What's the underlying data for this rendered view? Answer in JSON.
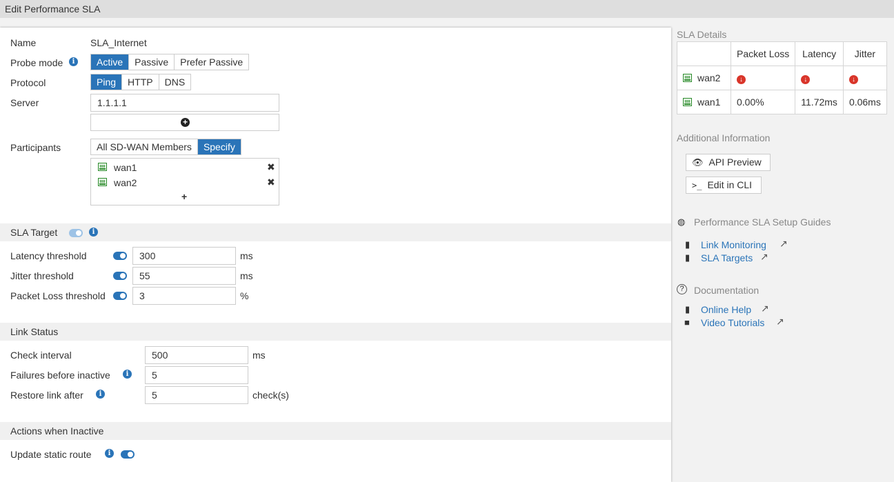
{
  "window": {
    "title": "Edit Performance SLA"
  },
  "form": {
    "name_label": "Name",
    "name_value": "SLA_Internet",
    "probe_mode_label": "Probe mode",
    "probe_modes": [
      "Active",
      "Passive",
      "Prefer Passive"
    ],
    "probe_mode_selected": "Active",
    "protocol_label": "Protocol",
    "protocols": [
      "Ping",
      "HTTP",
      "DNS"
    ],
    "protocol_selected": "Ping",
    "server_label": "Server",
    "server_value": "1.1.1.1",
    "participants_label": "Participants",
    "participant_modes": [
      "All SD-WAN Members",
      "Specify"
    ],
    "participant_mode_selected": "Specify",
    "participants": [
      "wan1",
      "wan2"
    ],
    "add_symbol": "+"
  },
  "sla_target": {
    "title": "SLA Target",
    "latency_label": "Latency threshold",
    "latency_value": "300",
    "latency_unit": "ms",
    "jitter_label": "Jitter threshold",
    "jitter_value": "55",
    "jitter_unit": "ms",
    "loss_label": "Packet Loss threshold",
    "loss_value": "3",
    "loss_unit": "%"
  },
  "link_status": {
    "title": "Link Status",
    "check_label": "Check interval",
    "check_value": "500",
    "check_unit": "ms",
    "failures_label": "Failures before inactive",
    "failures_value": "5",
    "restore_label": "Restore link after",
    "restore_value": "5",
    "restore_unit": "check(s)"
  },
  "actions": {
    "title": "Actions when Inactive",
    "update_route_label": "Update static route"
  },
  "sla_details": {
    "title": "SLA Details",
    "columns": [
      "Packet Loss",
      "Latency",
      "Jitter"
    ],
    "rows": [
      {
        "name": "wan2",
        "packet_loss": "",
        "latency": "",
        "jitter": ""
      },
      {
        "name": "wan1",
        "packet_loss": "0.00%",
        "latency": "11.72ms",
        "jitter": "0.06ms"
      }
    ],
    "status_color_down": "#d9352a"
  },
  "additional": {
    "title": "Additional Information",
    "api_preview": "API Preview",
    "edit_cli": "Edit in CLI"
  },
  "guides": {
    "title": "Performance SLA Setup Guides",
    "links": [
      "Link Monitoring",
      "SLA Targets"
    ]
  },
  "documentation": {
    "title": "Documentation",
    "online_help": "Online Help",
    "video_tutorials": "Video Tutorials"
  },
  "colors": {
    "accent": "#2a74b8",
    "panel_bg": "#ffffff",
    "page_bg": "#f2f2f2"
  }
}
